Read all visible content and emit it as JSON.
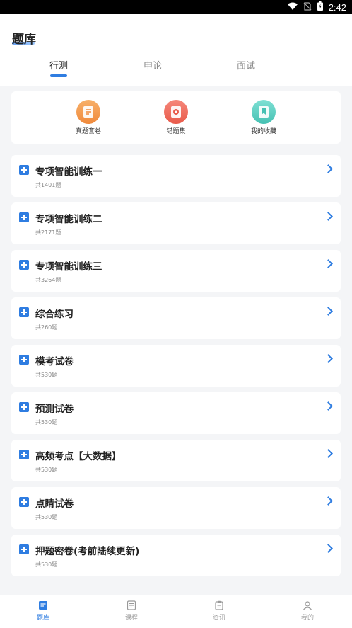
{
  "status_bar": {
    "time": "2:42"
  },
  "header": {
    "title": "题库"
  },
  "tabs": [
    {
      "label": "行测",
      "active": true
    },
    {
      "label": "申论",
      "active": false
    },
    {
      "label": "面试",
      "active": false
    }
  ],
  "quick_actions": [
    {
      "label": "真题套卷",
      "icon": "document-icon",
      "color": "#f39a4c"
    },
    {
      "label": "错题集",
      "icon": "error-book-icon",
      "color": "#ef6b5b"
    },
    {
      "label": "我的收藏",
      "icon": "bookmark-icon",
      "color": "#5fcfc2"
    }
  ],
  "modules": [
    {
      "title": "专项智能训练一",
      "count": "共1401题"
    },
    {
      "title": "专项智能训练二",
      "count": "共2171题"
    },
    {
      "title": "专项智能训练三",
      "count": "共3264题"
    },
    {
      "title": "综合练习",
      "count": "共260题"
    },
    {
      "title": "模考试卷",
      "count": "共530题"
    },
    {
      "title": "预测试卷",
      "count": "共530题"
    },
    {
      "title": "高频考点【大数据】",
      "count": "共530题"
    },
    {
      "title": "点睛试卷",
      "count": "共530题"
    },
    {
      "title": "押题密卷(考前陆续更新)",
      "count": "共530题"
    }
  ],
  "bottom_nav": [
    {
      "label": "题库",
      "icon": "question-bank-icon",
      "active": true
    },
    {
      "label": "课程",
      "icon": "course-icon",
      "active": false
    },
    {
      "label": "资讯",
      "icon": "news-icon",
      "active": false
    },
    {
      "label": "我的",
      "icon": "profile-icon",
      "active": false
    }
  ],
  "colors": {
    "accent": "#2f7de1",
    "background": "#f4f5f7"
  }
}
